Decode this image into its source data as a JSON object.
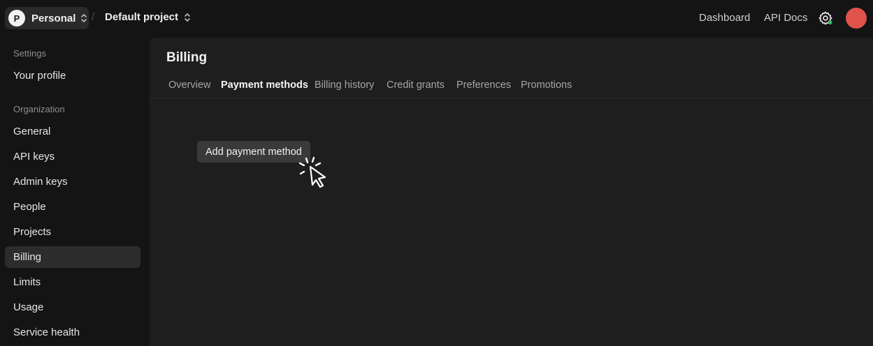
{
  "header": {
    "org_initial": "P",
    "org_name": "Personal",
    "separator": "/",
    "project_name": "Default project",
    "links": [
      "Dashboard",
      "API Docs"
    ],
    "settings_icon": "gear-icon",
    "avatar_color": "#e0534a"
  },
  "sidebar": {
    "sections": [
      {
        "title": "Settings",
        "items": [
          "Your profile"
        ]
      },
      {
        "title": "Organization",
        "items": [
          "General",
          "API keys",
          "Admin keys",
          "People",
          "Projects",
          "Billing",
          "Limits",
          "Usage",
          "Service health"
        ]
      }
    ],
    "active_item": "Billing"
  },
  "main": {
    "title": "Billing",
    "tabs": [
      "Overview",
      "Payment methods",
      "Billing history",
      "Credit grants",
      "Preferences",
      "Promotions"
    ],
    "active_tab": "Payment methods",
    "tooltip": "Add payment method"
  }
}
